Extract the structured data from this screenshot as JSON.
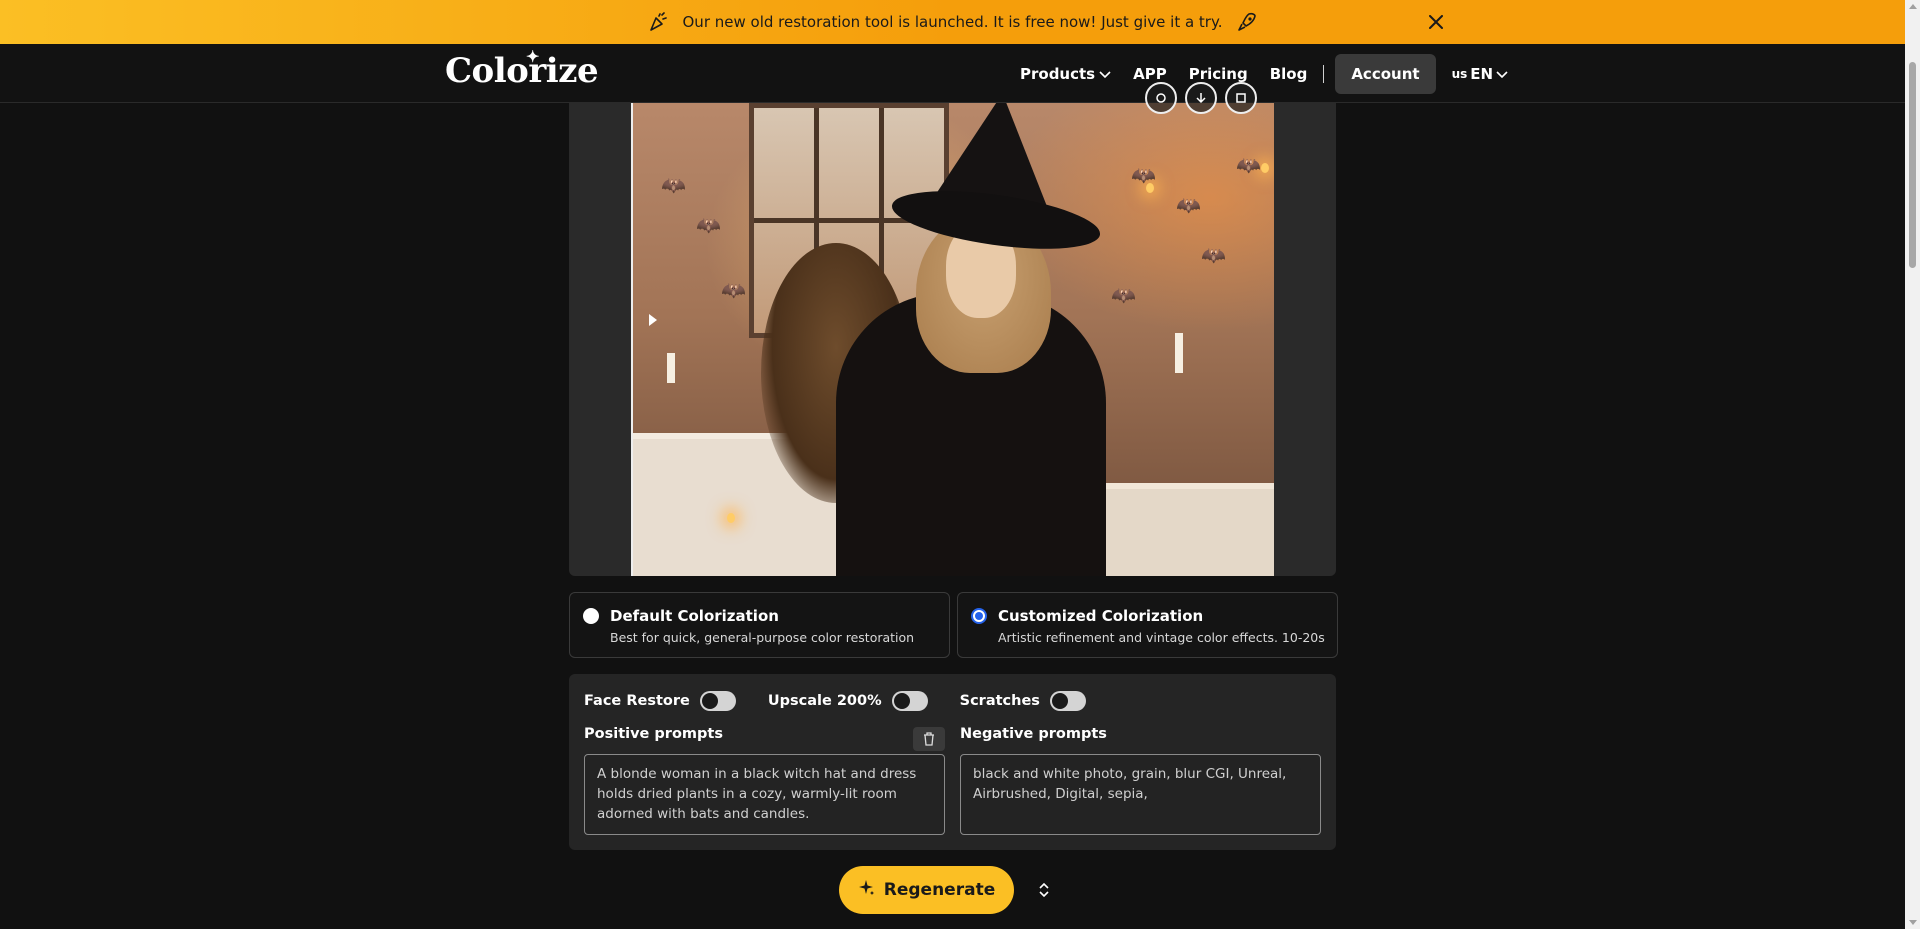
{
  "banner": {
    "message": "Our new old restoration tool is launched. It is free now! Just give it a try.",
    "bg_color": "#f59e0b"
  },
  "header": {
    "logo": "Colorize",
    "nav": {
      "products": "Products",
      "app": "APP",
      "pricing": "Pricing",
      "blog": "Blog",
      "account": "Account",
      "lang_flag": "us",
      "lang": "EN"
    }
  },
  "modes": [
    {
      "title": "Default Colorization",
      "desc": "Best for quick, general-purpose color restoration",
      "selected": false
    },
    {
      "title": "Customized Colorization",
      "desc": "Artistic refinement and vintage color effects. 10-20s",
      "selected": true
    }
  ],
  "options": {
    "toggles": [
      {
        "label": "Face Restore",
        "on": false
      },
      {
        "label": "Upscale 200%",
        "on": false
      },
      {
        "label": "Scratches",
        "on": false
      }
    ],
    "positive_label": "Positive prompts",
    "negative_label": "Negative prompts",
    "positive_value": "A blonde woman in a black witch hat and dress holds dried plants in a cozy, warmly-lit room adorned with bats and candles.",
    "negative_value": "black and white photo, grain, blur  CGI, Unreal, Airbrushed, Digital, sepia,"
  },
  "actions": {
    "regenerate": "Regenerate",
    "accent_color": "#fbbf24"
  }
}
